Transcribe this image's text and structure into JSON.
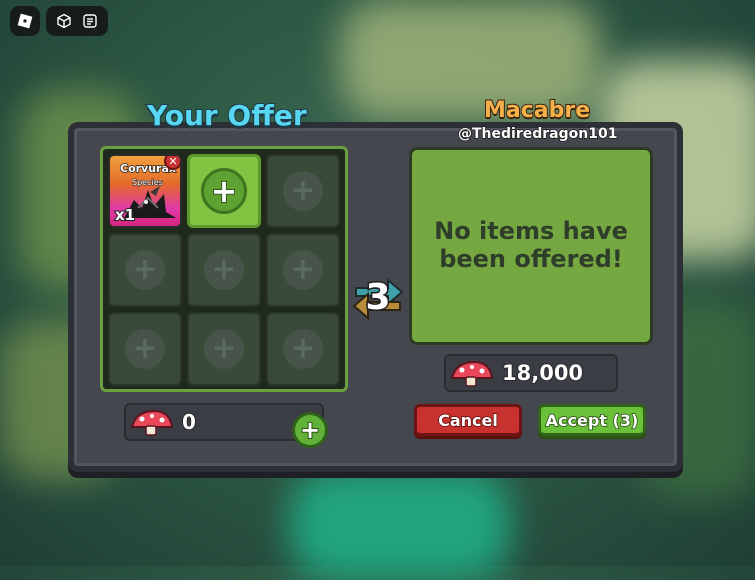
{
  "your_offer": {
    "title": "Your Offer",
    "item": {
      "name": "Corvurax",
      "subtitle": "Species",
      "quantity": "x1"
    },
    "currency_amount": "0"
  },
  "their_offer": {
    "name": "Macabre",
    "handle": "@Thediredragon101",
    "empty_message": "No items have been offered!",
    "currency_amount": "18,000"
  },
  "counter": "3",
  "buttons": {
    "cancel": "Cancel",
    "accept": "Accept (3)"
  },
  "icons": {
    "roblox_menu": "roblox-logo-icon",
    "selfie": "cube-icon",
    "chat": "chat-icon",
    "currency": "mushroom-icon",
    "add": "plus-icon",
    "remove": "close-icon",
    "swap": "swap-arrows-icon"
  },
  "colors": {
    "your_offer_title": "#58d7f3",
    "partner_name": "#f5b04a",
    "accept": "#6cc13b",
    "cancel": "#c9322e"
  }
}
